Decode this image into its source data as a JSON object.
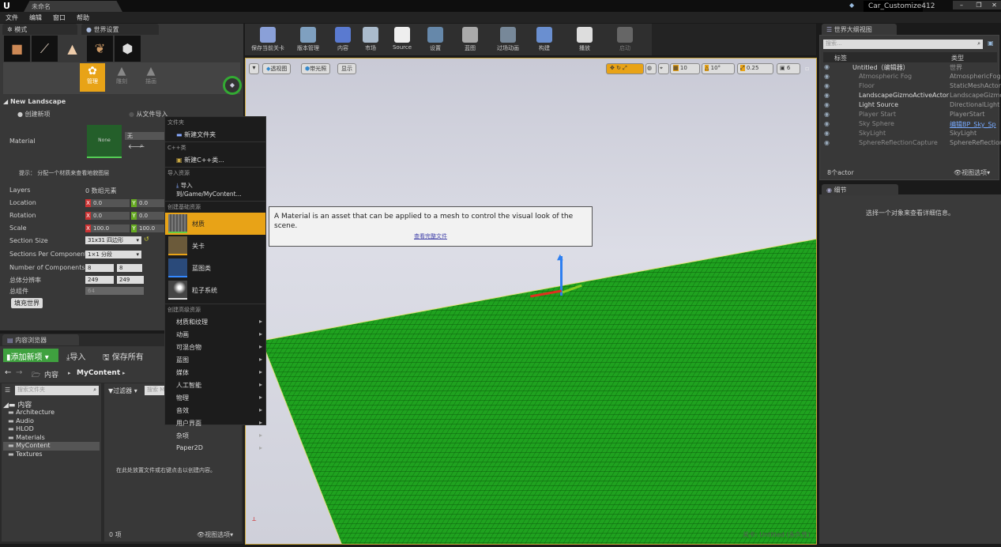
{
  "window": {
    "tab": "未命名",
    "project": "Car_Customize412",
    "logo": "U"
  },
  "menu": [
    "文件",
    "编辑",
    "窗口",
    "帮助"
  ],
  "modes": {
    "tab": "模式",
    "world_tab": "世界设置",
    "tools": [
      "place-icon",
      "paint-icon",
      "landscape-icon",
      "foliage-icon",
      "geometry-icon"
    ],
    "subtools": [
      "管理",
      "雕刻",
      "描画"
    ],
    "section": "New Landscape",
    "radio_new": "创建新项",
    "radio_import": "从文件导入",
    "material_label": "Material",
    "material_thumb": "None",
    "material_value": "无",
    "hint": "提示： 分配一个材质来查看地貌图层",
    "layers_label": "Layers",
    "layers_value": "0 数组元素",
    "location_label": "Location",
    "location": {
      "x": "0.0",
      "y": "0.0"
    },
    "rotation_label": "Rotation",
    "rotation": {
      "x": "0.0",
      "y": "0.0"
    },
    "scale_label": "Scale",
    "scale": {
      "x": "100.0",
      "y": "100.0"
    },
    "section_size_label": "Section Size",
    "section_size": "31x31 四边形",
    "sections_per_label": "Sections Per Component",
    "sections_per": "1×1 分段",
    "num_comp_label": "Number of Components",
    "num_comp": {
      "x": "8",
      "y": "8"
    },
    "resolution_label": "总体分辨率",
    "resolution": {
      "x": "249",
      "y": "249"
    },
    "total_label": "总组件",
    "total": "64",
    "fill_button": "填充世界"
  },
  "content_browser": {
    "tab": "内容浏览器",
    "add_new": "添加新项",
    "import": "导入",
    "save_all": "保存所有",
    "breadcrumb": [
      "内容",
      "MyContent"
    ],
    "search_folders": "搜索文件夹",
    "filters": "过滤器",
    "search_assets": "搜索 M",
    "tree_root": "内容",
    "folders": [
      "Architecture",
      "Audio",
      "HLOD",
      "Materials",
      "MyContent",
      "Textures"
    ],
    "selected": "MyContent",
    "empty": "在此处放置文件或右键点击以创建内容。",
    "count": "0 项",
    "view_options": "视图选项"
  },
  "context_menu": {
    "h_folder": "文件夹",
    "new_folder": "新建文件夹",
    "h_cpp": "C++类",
    "new_cpp": "新建C++类...",
    "h_import": "导入资源",
    "import_to": "导入到/Game/MyContent...",
    "h_basic": "创建基础资源",
    "basic": [
      "材质",
      "关卡",
      "蓝图类",
      "粒子系统"
    ],
    "highlighted": "材质",
    "h_adv": "创建高级资源",
    "advanced": [
      "材质和纹理",
      "动画",
      "可混合物",
      "蓝图",
      "媒体",
      "人工智能",
      "物理",
      "音效",
      "用户界面",
      "杂项",
      "Paper2D"
    ]
  },
  "tooltip": {
    "text": "A Material is an asset that can be applied to a mesh to control the visual look of the scene.",
    "link": "查看完整文件"
  },
  "toolbar": [
    {
      "label": "保存当前关卡",
      "color": "#8aa0d8"
    },
    {
      "label": "版本管理",
      "color": "#7fa0c0"
    },
    {
      "label": "内容",
      "color": "#5a7ad0"
    },
    {
      "label": "市场",
      "color": "#aabbcc"
    },
    {
      "label": "Source",
      "color": "#eeeeee"
    },
    {
      "label": "设置",
      "color": "#6688aa"
    },
    {
      "label": "蓝图",
      "color": "#aaaaaa"
    },
    {
      "label": "过场动画",
      "color": "#778899"
    },
    {
      "label": "构建",
      "color": "#6a8fd0"
    },
    {
      "label": "播放",
      "color": "#dddddd"
    },
    {
      "label": "启动",
      "color": "#666666"
    }
  ],
  "viewport": {
    "menu": "▾",
    "perspective": "透视图",
    "lit": "带光照",
    "show": "显示",
    "grid_snap": "10",
    "rot_snap": "10°",
    "scale_snap": "0.25",
    "cam_speed": "6",
    "level_label": "关卡: Untitled (永久性)"
  },
  "outliner": {
    "tab": "世界大纲视图",
    "search": "搜索...",
    "col_label": "标签",
    "col_type": "类型",
    "rows": [
      {
        "name": "Untitled（编辑器）",
        "type": "世界"
      },
      {
        "name": "Atmospheric Fog",
        "type": "AtmosphericFog"
      },
      {
        "name": "Floor",
        "type": "StaticMeshActor"
      },
      {
        "name": "LandscapeGizmoActiveActor",
        "type": "LandscapeGizmo"
      },
      {
        "name": "Light Source",
        "type": "DirectionalLight"
      },
      {
        "name": "Player Start",
        "type": "PlayerStart"
      },
      {
        "name": "Sky Sphere",
        "type": "编辑BP_Sky_Sp"
      },
      {
        "name": "SkyLight",
        "type": "SkyLight"
      },
      {
        "name": "SphereReflectionCapture",
        "type": "SphereReflection"
      }
    ],
    "count": "8个actor",
    "view_options": "视图选项"
  },
  "details": {
    "tab": "细节",
    "empty": "选择一个对象来查看详细信息。"
  },
  "colors": {
    "accent": "#e8a317",
    "landscape": "#1fa21f",
    "add_button": "#3fa13f"
  }
}
